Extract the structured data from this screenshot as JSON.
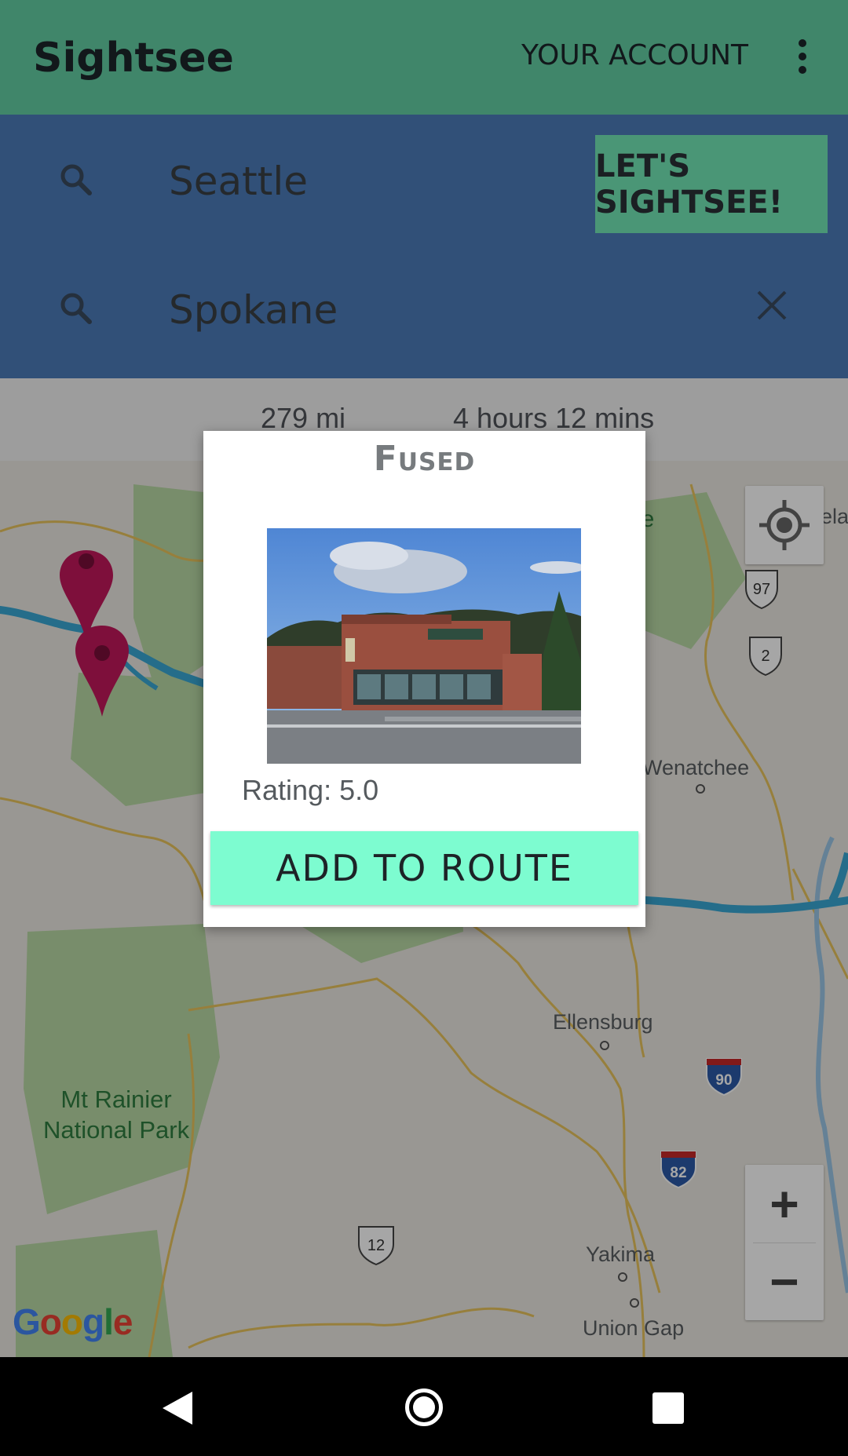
{
  "appbar": {
    "title": "Sightsee",
    "account_label": "YOUR ACCOUNT",
    "overflow_icon": "more-vert-icon"
  },
  "search": {
    "origin_value": "Seattle",
    "destination_value": "Spokane",
    "search_icon": "search-icon",
    "clear_icon": "close-icon",
    "go_button_label": "LET'S SIGHTSEE!"
  },
  "route": {
    "distance": "279 mi",
    "duration": "4 hours 12 mins"
  },
  "map": {
    "labels": {
      "wenatchee": "Wenatchee",
      "ellensburg": "Ellensburg",
      "yakima": "Yakima",
      "union_gap": "Union Gap",
      "chelan_partial": "helar",
      "leavenworth_partial": "ee",
      "park": "Mt Rainier\nNational Park"
    },
    "highway_shields": [
      "97",
      "2",
      "90",
      "82",
      "12"
    ],
    "zoom_in_label": "+",
    "zoom_out_label": "−",
    "my_location_icon": "my-location-icon",
    "attribution": "Google",
    "route_color": "#3aa8d4",
    "marker_color": "#c2185b"
  },
  "dialog": {
    "title": "Fused",
    "rating": "Rating: 5.0",
    "add_button_label": "ADD TO ROUTE",
    "photo_desc_icon": "storefront-photo"
  },
  "navbar": {
    "back_icon": "back-icon",
    "home_icon": "home-icon",
    "recents_icon": "recents-icon"
  },
  "colors": {
    "appbar": "#6ee7b7",
    "search_bg": "#4c7bb8",
    "accent_button": "#7dfcd0"
  }
}
